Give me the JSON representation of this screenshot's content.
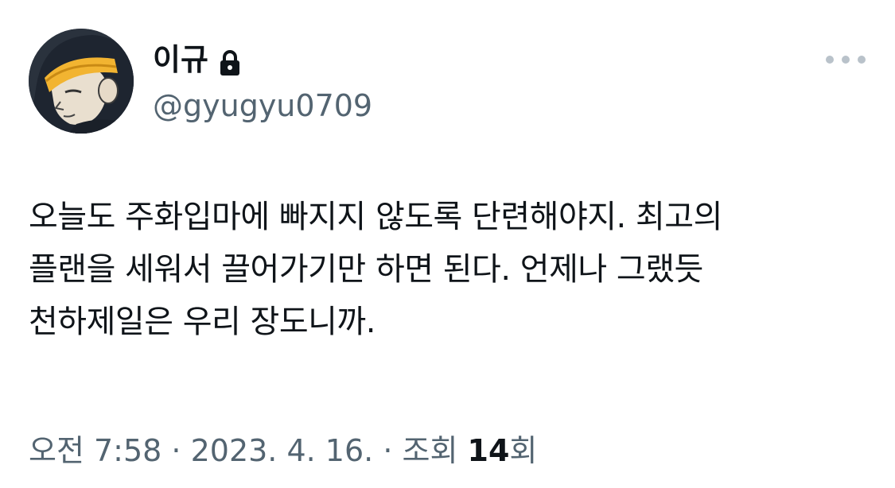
{
  "user": {
    "display_name": "이규",
    "handle": "@gyugyu0709",
    "locked": true
  },
  "tweet": {
    "text": "오늘도 주화입마에 빠지지 않도록 단련해야지. 최고의\n플랜을 세워서 끌어가기만 하면 된다. 언제나 그랬듯\n천하제일은 우리 장도니까."
  },
  "meta": {
    "time": "오전 7:58",
    "separator": " · ",
    "date": "2023. 4. 16.",
    "views_label": "조회",
    "views_count": "14",
    "views_suffix": "회"
  },
  "icons": {
    "lock": "lock-icon",
    "more": "more-horizontal-icon"
  },
  "colors": {
    "text_primary": "#0f1419",
    "text_secondary": "#536471",
    "dots": "#b9c2ca"
  }
}
